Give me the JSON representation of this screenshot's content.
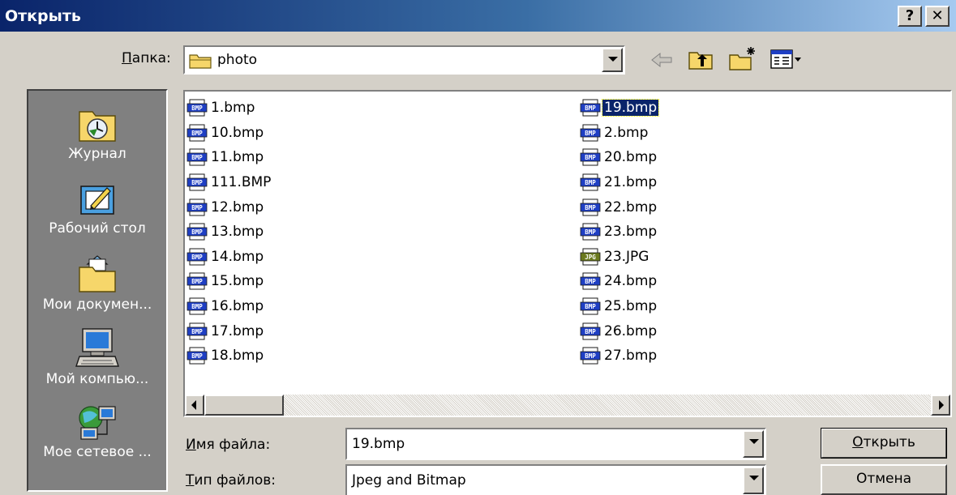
{
  "title": "Открыть",
  "title_buttons": {
    "help": "?",
    "close": "✕"
  },
  "folder": {
    "label_accel": "П",
    "label_rest": "апка:",
    "value": "photo",
    "icon": "folder-icon"
  },
  "toolbar": [
    "back-arrow-icon",
    "up-folder-icon",
    "new-folder-icon",
    "view-menu-icon"
  ],
  "places": [
    {
      "label": "Журнал",
      "icon": "history-icon"
    },
    {
      "label": "Рабочий стол",
      "icon": "desktop-icon"
    },
    {
      "label": "Мои докумен...",
      "icon": "my-documents-icon"
    },
    {
      "label": "Мой компью...",
      "icon": "my-computer-icon"
    },
    {
      "label": "Мое сетевое ...",
      "icon": "network-places-icon"
    }
  ],
  "files_col1": [
    {
      "name": "1.bmp",
      "type": "bmp"
    },
    {
      "name": "10.bmp",
      "type": "bmp"
    },
    {
      "name": "11.bmp",
      "type": "bmp"
    },
    {
      "name": "111.BMP",
      "type": "bmp"
    },
    {
      "name": "12.bmp",
      "type": "bmp"
    },
    {
      "name": "13.bmp",
      "type": "bmp"
    },
    {
      "name": "14.bmp",
      "type": "bmp"
    },
    {
      "name": "15.bmp",
      "type": "bmp"
    },
    {
      "name": "16.bmp",
      "type": "bmp"
    },
    {
      "name": "17.bmp",
      "type": "bmp"
    },
    {
      "name": "18.bmp",
      "type": "bmp"
    }
  ],
  "files_col2": [
    {
      "name": "19.bmp",
      "type": "bmp",
      "selected": true
    },
    {
      "name": "2.bmp",
      "type": "bmp"
    },
    {
      "name": "20.bmp",
      "type": "bmp"
    },
    {
      "name": "21.bmp",
      "type": "bmp"
    },
    {
      "name": "22.bmp",
      "type": "bmp"
    },
    {
      "name": "23.bmp",
      "type": "bmp"
    },
    {
      "name": "23.JPG",
      "type": "jpg"
    },
    {
      "name": "24.bmp",
      "type": "bmp"
    },
    {
      "name": "25.bmp",
      "type": "bmp"
    },
    {
      "name": "26.bmp",
      "type": "bmp"
    },
    {
      "name": "27.bmp",
      "type": "bmp"
    }
  ],
  "icon_text": {
    "bmp": "BMP",
    "jpg": "JPG"
  },
  "filename": {
    "label_accel": "И",
    "label_rest": "мя файла:",
    "value": "19.bmp"
  },
  "filetype": {
    "label_accel": "Т",
    "label_rest": "ип файлов:",
    "value": "Jpeg and Bitmap"
  },
  "buttons": {
    "open_accel": "О",
    "open_rest": "ткрыть",
    "cancel": "Отмена"
  },
  "colors": {
    "title_start": "#0a246a",
    "title_end": "#a6caf0",
    "face": "#d4d0c8",
    "places_bg": "#808080",
    "bmp_icon": "#1f3fc4",
    "jpg_icon": "#6b7a1e",
    "selection": "#0a246a"
  }
}
